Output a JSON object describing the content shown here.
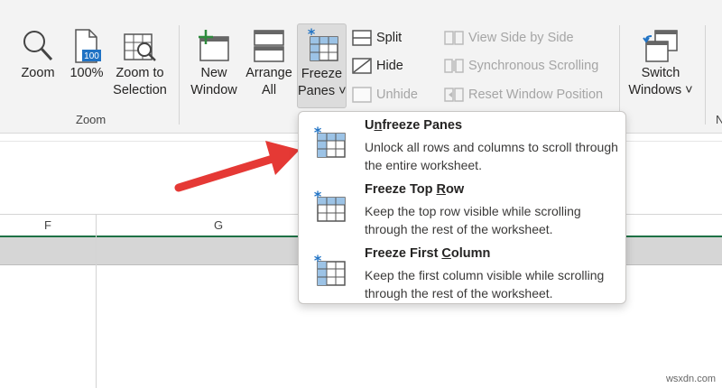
{
  "ribbon": {
    "zoom_group": {
      "label": "Zoom",
      "zoom": "Zoom",
      "hundred": "100%",
      "hundred_badge": "100",
      "zoom_to_selection": "Zoom to\nSelection"
    },
    "window_group": {
      "new_window": "New\nWindow",
      "arrange_all": "Arrange\nAll",
      "freeze_panes": "Freeze\nPanes ˅",
      "split": "Split",
      "hide": "Hide",
      "unhide": "Unhide",
      "view_side_by_side": "View Side by Side",
      "synchronous_scrolling": "Synchronous Scrolling",
      "reset_window_position": "Reset Window Position",
      "switch_windows": "Switch\nWindows ˅"
    },
    "clipped_label": "N"
  },
  "grid": {
    "columns": [
      "F",
      "G"
    ]
  },
  "freeze_menu": {
    "items": [
      {
        "title_pre": "U",
        "title_u": "n",
        "title_post": "freeze Panes",
        "desc": "Unlock all rows and columns to scroll through the entire worksheet."
      },
      {
        "title_pre": "Freeze Top ",
        "title_u": "R",
        "title_post": "ow",
        "desc": "Keep the top row visible while scrolling through the rest of the worksheet."
      },
      {
        "title_pre": "Freeze First ",
        "title_u": "C",
        "title_post": "olumn",
        "desc": "Keep the first column visible while scrolling through the rest of the worksheet."
      }
    ]
  },
  "colors": {
    "accent_red": "#e53935",
    "grid_green": "#1e7145",
    "icon_blue": "#1f72c4"
  },
  "watermark": "wsxdn.com"
}
